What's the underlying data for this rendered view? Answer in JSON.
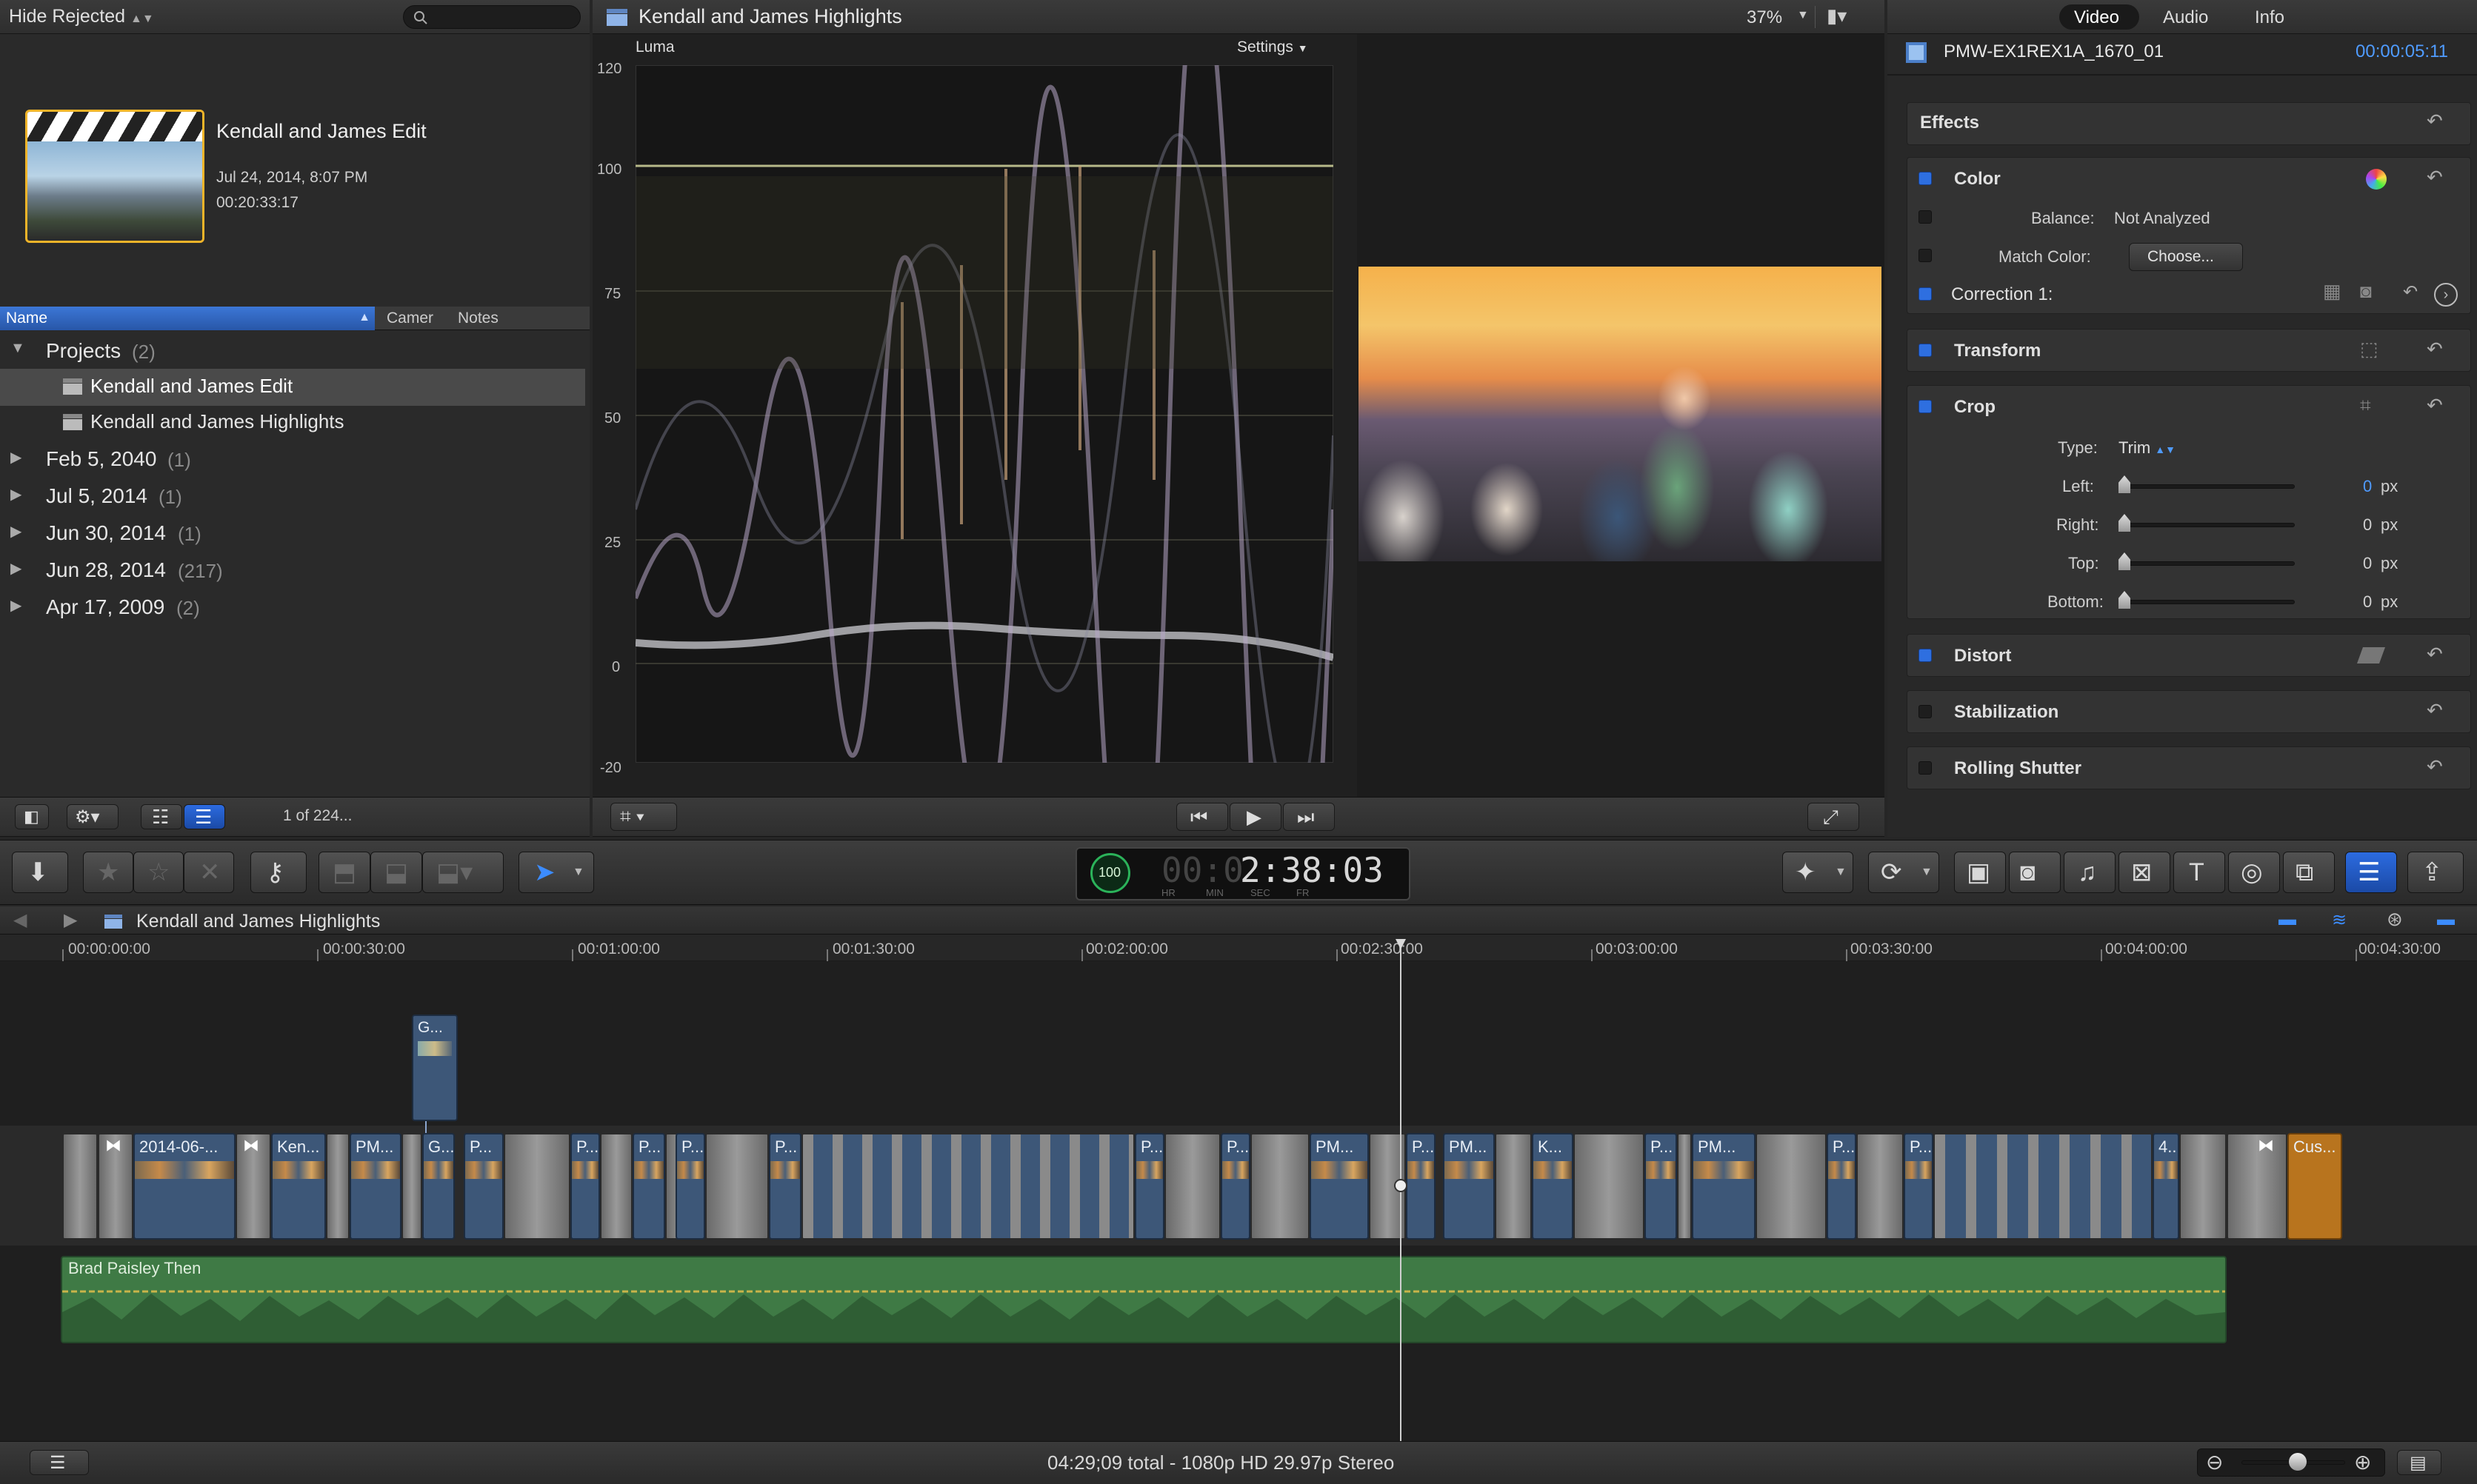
{
  "browser": {
    "filter_label": "Hide Rejected",
    "event_title": "Kendall and James Edit",
    "event_date": "Jul 24, 2014, 8:07 PM",
    "event_duration": "00:20:33:17",
    "columns": [
      "Name",
      "Camer",
      "Notes"
    ],
    "projects_label": "Projects",
    "projects_count": "(2)",
    "project_items": [
      "Kendall and James Edit",
      "Kendall and James Highlights"
    ],
    "events": [
      {
        "label": "Feb 5, 2040",
        "count": "(1)"
      },
      {
        "label": "Jul 5, 2014",
        "count": "(1)"
      },
      {
        "label": "Jun 30, 2014",
        "count": "(1)"
      },
      {
        "label": "Jun 28, 2014",
        "count": "(217)"
      },
      {
        "label": "Apr 17, 2009",
        "count": "(2)"
      }
    ],
    "selection_count": "1 of 224..."
  },
  "viewer": {
    "title": "Kendall and James Highlights",
    "zoom": "37%",
    "scope_label": "Luma",
    "settings_label": "Settings",
    "scale_labels": [
      "120",
      "100",
      "75",
      "50",
      "25",
      "0",
      "-20"
    ]
  },
  "inspector": {
    "tabs": [
      "Video",
      "Audio",
      "Info"
    ],
    "clip_name": "PMW-EX1REX1A_1670_01",
    "clip_duration": "00:00:05:11",
    "effects_label": "Effects",
    "color_label": "Color",
    "balance_label": "Balance:",
    "balance_value": "Not Analyzed",
    "match_label": "Match Color:",
    "match_button": "Choose...",
    "correction_label": "Correction 1:",
    "transform_label": "Transform",
    "crop_label": "Crop",
    "type_label": "Type:",
    "type_value": "Trim",
    "crop_fields": [
      {
        "label": "Left:",
        "value": "0",
        "unit": "px"
      },
      {
        "label": "Right:",
        "value": "0",
        "unit": "px"
      },
      {
        "label": "Top:",
        "value": "0",
        "unit": "px"
      },
      {
        "label": "Bottom:",
        "value": "0",
        "unit": "px"
      }
    ],
    "distort_label": "Distort",
    "stabilization_label": "Stabilization",
    "rolling_label": "Rolling Shutter"
  },
  "toolbar": {
    "timecode": "2:38:03",
    "timecode_dim": "00:0",
    "timecode_units": [
      "HR",
      "MIN",
      "SEC",
      "FR"
    ],
    "dial_value": "100"
  },
  "timeline": {
    "project_name": "Kendall and James Highlights",
    "ruler": [
      "00:00:00:00",
      "00:00:30:00",
      "00:01:00:00",
      "00:01:30:00",
      "00:02:00:00",
      "00:02:30:00",
      "00:03:00:00",
      "00:03:30:00",
      "00:04:00:00",
      "00:04:30:00"
    ],
    "connected_clip": "G...",
    "clip_labels": [
      "2014-06-...",
      "Ken...",
      "PM...",
      "G...",
      "P...",
      "P...",
      "P...",
      "P...",
      "P...",
      "P...",
      "P...",
      "PM...",
      "P...",
      "PM...",
      "K...",
      "P...",
      "PM...",
      "P...",
      "P...",
      "4...",
      "Cus..."
    ],
    "audio_label": "Brad Paisley Then",
    "status": "04:29;09 total - 1080p HD 29.97p Stereo"
  }
}
